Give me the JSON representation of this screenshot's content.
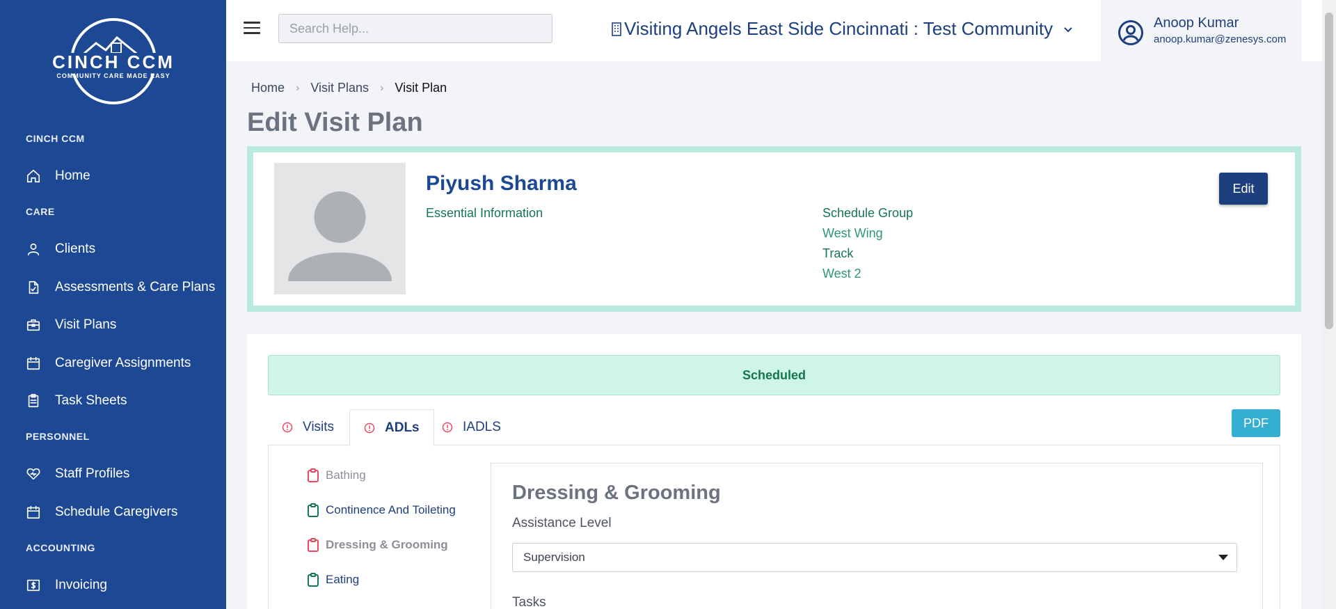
{
  "brand": {
    "logo_name": "CINCH CCM",
    "logo_tagline": "COMMUNITY CARE MADE EASY"
  },
  "sidebar": {
    "sections": [
      {
        "title": "CINCH CCM",
        "items": [
          {
            "label": "Home",
            "icon": "home-icon"
          }
        ]
      },
      {
        "title": "CARE",
        "items": [
          {
            "label": "Clients",
            "icon": "person-icon"
          },
          {
            "label": "Assessments & Care Plans",
            "icon": "document-icon"
          },
          {
            "label": "Visit Plans",
            "icon": "briefcase-icon"
          },
          {
            "label": "Caregiver Assignments",
            "icon": "calendar-icon"
          },
          {
            "label": "Task Sheets",
            "icon": "clipboard-icon"
          }
        ]
      },
      {
        "title": "PERSONNEL",
        "items": [
          {
            "label": "Staff Profiles",
            "icon": "heart-icon"
          },
          {
            "label": "Schedule Caregivers",
            "icon": "calendar-icon"
          }
        ]
      },
      {
        "title": "ACCOUNTING",
        "items": [
          {
            "label": "Invoicing",
            "icon": "invoice-icon"
          }
        ]
      }
    ]
  },
  "topbar": {
    "search_placeholder": "Search Help...",
    "community": "Visiting Angels East Side Cincinnati : Test Community",
    "user_name": "Anoop Kumar",
    "user_email": "anoop.kumar@zenesys.com"
  },
  "breadcrumb": [
    "Home",
    "Visit Plans",
    "Visit Plan"
  ],
  "page_title": "Edit Visit Plan",
  "client": {
    "name": "Piyush Sharma",
    "essential_label": "Essential Information",
    "schedule_group_label": "Schedule Group",
    "schedule_group_value": "West Wing",
    "track_label": "Track",
    "track_value": "West 2",
    "edit_label": "Edit"
  },
  "status": "Scheduled",
  "tabs": [
    {
      "label": "Visits",
      "active": false
    },
    {
      "label": "ADLs",
      "active": true
    },
    {
      "label": "IADLS",
      "active": false
    }
  ],
  "pdf_label": "PDF",
  "adls": [
    {
      "label": "Bathing",
      "state": "incomplete"
    },
    {
      "label": "Continence And Toileting",
      "state": "complete"
    },
    {
      "label": "Dressing & Grooming",
      "state": "incomplete",
      "selected": true
    },
    {
      "label": "Eating",
      "state": "complete"
    }
  ],
  "detail": {
    "title": "Dressing & Grooming",
    "assistance_label": "Assistance Level",
    "assistance_value": "Supervision",
    "tasks_label": "Tasks"
  },
  "colors": {
    "sidebar": "#1d4893",
    "primary": "#1d3f7e",
    "success_bg": "#cff5e8",
    "alert_red": "#e8485d",
    "complete_green": "#14755a",
    "pdf_button": "#35afd1"
  }
}
